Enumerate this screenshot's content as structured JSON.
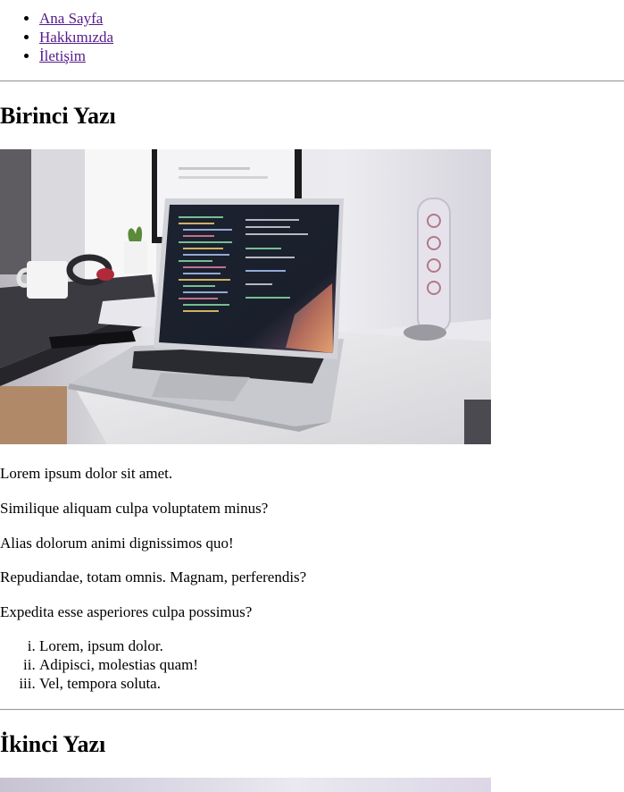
{
  "nav": {
    "items": [
      {
        "label": "Ana Sayfa"
      },
      {
        "label": "Hakkımızda"
      },
      {
        "label": "İletişim"
      }
    ]
  },
  "post1": {
    "title": "Birinci Yazı",
    "paragraphs": [
      "Lorem ipsum dolor sit amet.",
      "Similique aliquam culpa voluptatem minus?",
      "Alias dolorum animi dignissimos quo!",
      "Repudiandae, totam omnis. Magnam, perferendis?",
      "Expedita esse asperiores culpa possimus?"
    ],
    "list": [
      "Lorem, ipsum dolor.",
      "Adipisci, molestias quam!",
      "Vel, tempora soluta."
    ]
  },
  "post2": {
    "title": "İkinci Yazı"
  },
  "colors": {
    "link_visited": "#551a8b",
    "rule": "#9a9a9a"
  }
}
